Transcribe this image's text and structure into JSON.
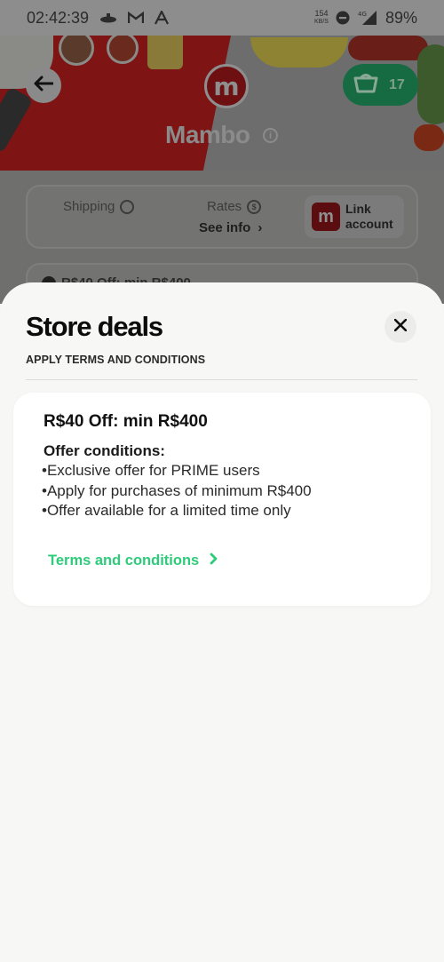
{
  "status_bar": {
    "time": "02:42:39",
    "net_speed_value": "154",
    "net_speed_unit": "KB/S",
    "network_type": "4G",
    "battery": "89%"
  },
  "header": {
    "store_name": "Mambo",
    "logo_letter": "m",
    "cart_count": "17"
  },
  "store_info": {
    "shipping_label": "Shipping",
    "rates_label": "Rates",
    "see_info_label": "See info",
    "link_account_label_line1": "Link",
    "link_account_label_line2": "account",
    "deal_row_text": "R$40 Off: min R$400"
  },
  "sheet": {
    "title": "Store deals",
    "subtitle": "APPLY TERMS AND CONDITIONS",
    "deal": {
      "title": "R$40 Off: min R$400",
      "conditions_title": "Offer conditions:",
      "conditions": [
        "•Exclusive offer for PRIME users",
        "•Apply for purchases of minimum R$400",
        "•Offer available for a limited time only"
      ],
      "terms_link": "Terms and conditions"
    }
  },
  "colors": {
    "accent_green": "#2ecc7a",
    "brand_red": "#d8232a"
  }
}
